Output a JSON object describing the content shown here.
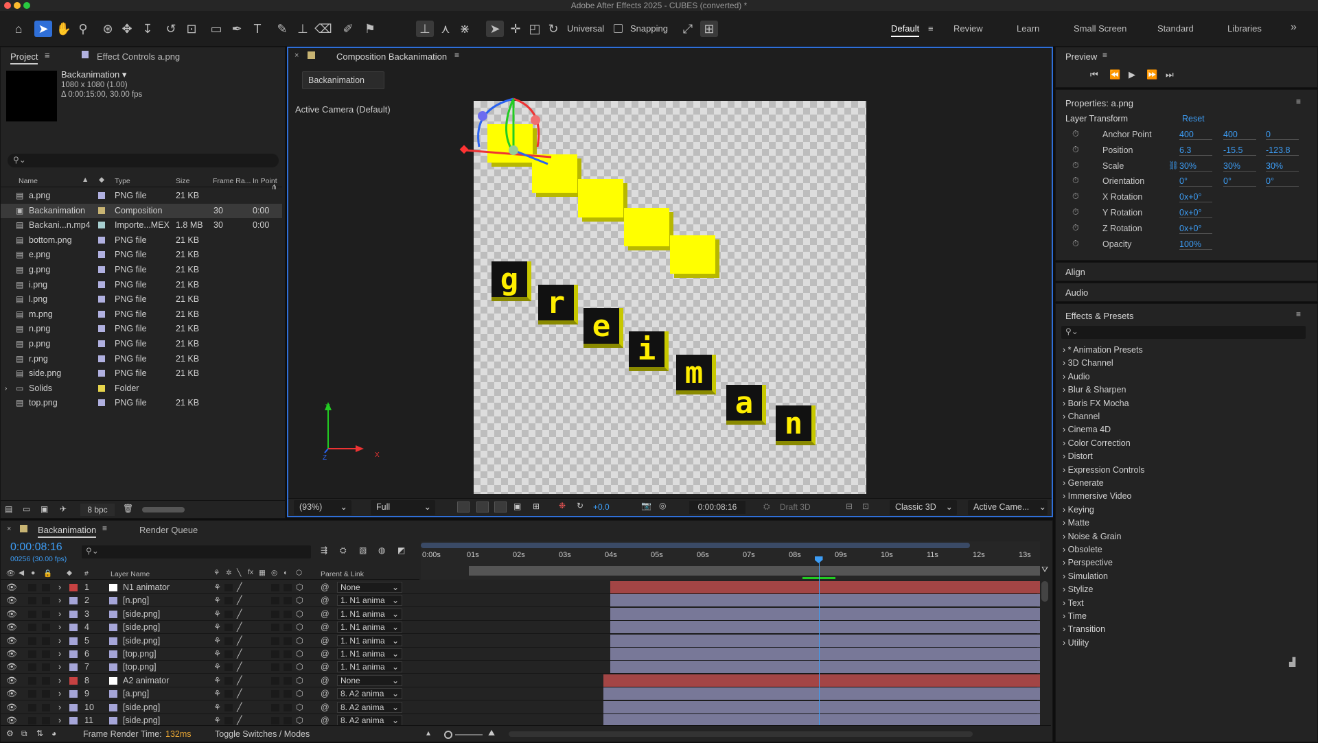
{
  "app": {
    "title": "Adobe After Effects 2025 - CUBES (converted) *"
  },
  "toolbar": {
    "universal_label": "Universal",
    "snapping_label": "Snapping"
  },
  "workspaces": [
    "Default",
    "Review",
    "Learn",
    "Small Screen",
    "Standard",
    "Libraries"
  ],
  "project": {
    "tab": "Project",
    "effect_controls_tab": "Effect Controls a.png",
    "comp_name": "Backanimation ▾",
    "comp_size": "1080 x 1080 (1.00)",
    "comp_duration": "Δ 0:00:15:00, 30.00 fps",
    "columns": {
      "name": "Name",
      "type": "Type",
      "size": "Size",
      "frame_rate": "Frame Ra...",
      "in_point": "In Point"
    },
    "items": [
      {
        "name": "a.png",
        "type": "PNG file",
        "size": "21 KB",
        "fps": "",
        "inpt": "",
        "color": "#b0b0e0"
      },
      {
        "name": "Backanimation",
        "type": "Composition",
        "size": "",
        "fps": "30",
        "inpt": "0:00",
        "color": "#c8b473"
      },
      {
        "name": "Backani...n.mp4",
        "type": "Importe...MEX",
        "size": "1.8 MB",
        "fps": "30",
        "inpt": "0:00",
        "color": "#a7cfd0"
      },
      {
        "name": "bottom.png",
        "type": "PNG file",
        "size": "21 KB",
        "fps": "",
        "inpt": "",
        "color": "#b0b0e0"
      },
      {
        "name": "e.png",
        "type": "PNG file",
        "size": "21 KB",
        "fps": "",
        "inpt": "",
        "color": "#b0b0e0"
      },
      {
        "name": "g.png",
        "type": "PNG file",
        "size": "21 KB",
        "fps": "",
        "inpt": "",
        "color": "#b0b0e0"
      },
      {
        "name": "i.png",
        "type": "PNG file",
        "size": "21 KB",
        "fps": "",
        "inpt": "",
        "color": "#b0b0e0"
      },
      {
        "name": "l.png",
        "type": "PNG file",
        "size": "21 KB",
        "fps": "",
        "inpt": "",
        "color": "#b0b0e0"
      },
      {
        "name": "m.png",
        "type": "PNG file",
        "size": "21 KB",
        "fps": "",
        "inpt": "",
        "color": "#b0b0e0"
      },
      {
        "name": "n.png",
        "type": "PNG file",
        "size": "21 KB",
        "fps": "",
        "inpt": "",
        "color": "#b0b0e0"
      },
      {
        "name": "p.png",
        "type": "PNG file",
        "size": "21 KB",
        "fps": "",
        "inpt": "",
        "color": "#b0b0e0"
      },
      {
        "name": "r.png",
        "type": "PNG file",
        "size": "21 KB",
        "fps": "",
        "inpt": "",
        "color": "#b0b0e0"
      },
      {
        "name": "side.png",
        "type": "PNG file",
        "size": "21 KB",
        "fps": "",
        "inpt": "",
        "color": "#b0b0e0"
      },
      {
        "name": "Solids",
        "type": "Folder",
        "size": "",
        "fps": "",
        "inpt": "",
        "color": "#e6d44b"
      },
      {
        "name": "top.png",
        "type": "PNG file",
        "size": "21 KB",
        "fps": "",
        "inpt": "",
        "color": "#b0b0e0"
      }
    ],
    "bpc": "8 bpc"
  },
  "composition": {
    "tab": "Composition Backanimation",
    "breadcrumb": "Backanimation",
    "camera_label": "Active Camera (Default)",
    "letters": [
      "g",
      "r",
      "e",
      "i",
      "m",
      "a",
      "n"
    ],
    "zoom": "(93%)",
    "resolution": "Full",
    "exposure": "+0.0",
    "timecode": "0:00:08:16",
    "draft3d": "Draft 3D",
    "renderer": "Classic 3D",
    "view": "Active Came...",
    "axis_x": "X",
    "axis_y": "Y",
    "axis_z": "Z"
  },
  "preview": {
    "title": "Preview"
  },
  "properties": {
    "title": "Properties: a.png",
    "section": "Layer Transform",
    "reset": "Reset",
    "rows": [
      {
        "name": "Anchor Point",
        "v1": "400",
        "v2": "400",
        "v3": "0"
      },
      {
        "name": "Position",
        "v1": "6.3",
        "v2": "-15.5",
        "v3": "-123.8"
      },
      {
        "name": "Scale",
        "v1": "30%",
        "v2": "30%",
        "v3": "30%"
      },
      {
        "name": "Orientation",
        "v1": "0°",
        "v2": "0°",
        "v3": "0°"
      },
      {
        "name": "X Rotation",
        "v1": "0x+0°",
        "v2": "",
        "v3": ""
      },
      {
        "name": "Y Rotation",
        "v1": "0x+0°",
        "v2": "",
        "v3": ""
      },
      {
        "name": "Z Rotation",
        "v1": "0x+0°",
        "v2": "",
        "v3": ""
      },
      {
        "name": "Opacity",
        "v1": "100%",
        "v2": "",
        "v3": ""
      }
    ]
  },
  "align": "Align",
  "audio": "Audio",
  "effects": {
    "title": "Effects & Presets",
    "items": [
      "* Animation Presets",
      "3D Channel",
      "Audio",
      "Blur & Sharpen",
      "Boris FX Mocha",
      "Channel",
      "Cinema 4D",
      "Color Correction",
      "Distort",
      "Expression Controls",
      "Generate",
      "Immersive Video",
      "Keying",
      "Matte",
      "Noise & Grain",
      "Obsolete",
      "Perspective",
      "Simulation",
      "Stylize",
      "Text",
      "Time",
      "Transition",
      "Utility"
    ]
  },
  "timeline": {
    "tab": "Backanimation",
    "render_queue": "Render Queue",
    "timecode": "0:00:08:16",
    "frames": "00256 (30.00 fps)",
    "col_layer_name": "Layer Name",
    "col_parent": "Parent & Link",
    "col_num": "#",
    "fx_label": "fx",
    "ruler": [
      "0:00s",
      "01s",
      "02s",
      "03s",
      "04s",
      "05s",
      "06s",
      "07s",
      "08s",
      "09s",
      "10s",
      "11s",
      "12s",
      "13s"
    ],
    "layers": [
      {
        "num": "1",
        "name": "N1 animator",
        "parent": "None",
        "color": "#c74242",
        "start_s": 4.0,
        "null": true
      },
      {
        "num": "2",
        "name": "[n.png]",
        "parent": "1. N1 anima",
        "color": "#a5a5d8",
        "start_s": 4.0,
        "null": false
      },
      {
        "num": "3",
        "name": "[side.png]",
        "parent": "1. N1 anima",
        "color": "#a5a5d8",
        "start_s": 4.0,
        "null": false
      },
      {
        "num": "4",
        "name": "[side.png]",
        "parent": "1. N1 anima",
        "color": "#a5a5d8",
        "start_s": 4.0,
        "null": false
      },
      {
        "num": "5",
        "name": "[side.png]",
        "parent": "1. N1 anima",
        "color": "#a5a5d8",
        "start_s": 4.0,
        "null": false
      },
      {
        "num": "6",
        "name": "[top.png]",
        "parent": "1. N1 anima",
        "color": "#a5a5d8",
        "start_s": 4.0,
        "null": false
      },
      {
        "num": "7",
        "name": "[top.png]",
        "parent": "1. N1 anima",
        "color": "#a5a5d8",
        "start_s": 4.0,
        "null": false
      },
      {
        "num": "8",
        "name": "A2 animator",
        "parent": "None",
        "color": "#c74242",
        "start_s": 3.85,
        "null": true
      },
      {
        "num": "9",
        "name": "[a.png]",
        "parent": "8. A2 anima",
        "color": "#a5a5d8",
        "start_s": 3.85,
        "null": false
      },
      {
        "num": "10",
        "name": "[side.png]",
        "parent": "8. A2 anima",
        "color": "#a5a5d8",
        "start_s": 3.85,
        "null": false
      },
      {
        "num": "11",
        "name": "[side.png]",
        "parent": "8. A2 anima",
        "color": "#a5a5d8",
        "start_s": 3.85,
        "null": false
      }
    ],
    "playhead_s": 8.53,
    "render_time_label": "Frame Render Time:",
    "render_time": "132ms",
    "toggle_label": "Toggle Switches / Modes"
  }
}
